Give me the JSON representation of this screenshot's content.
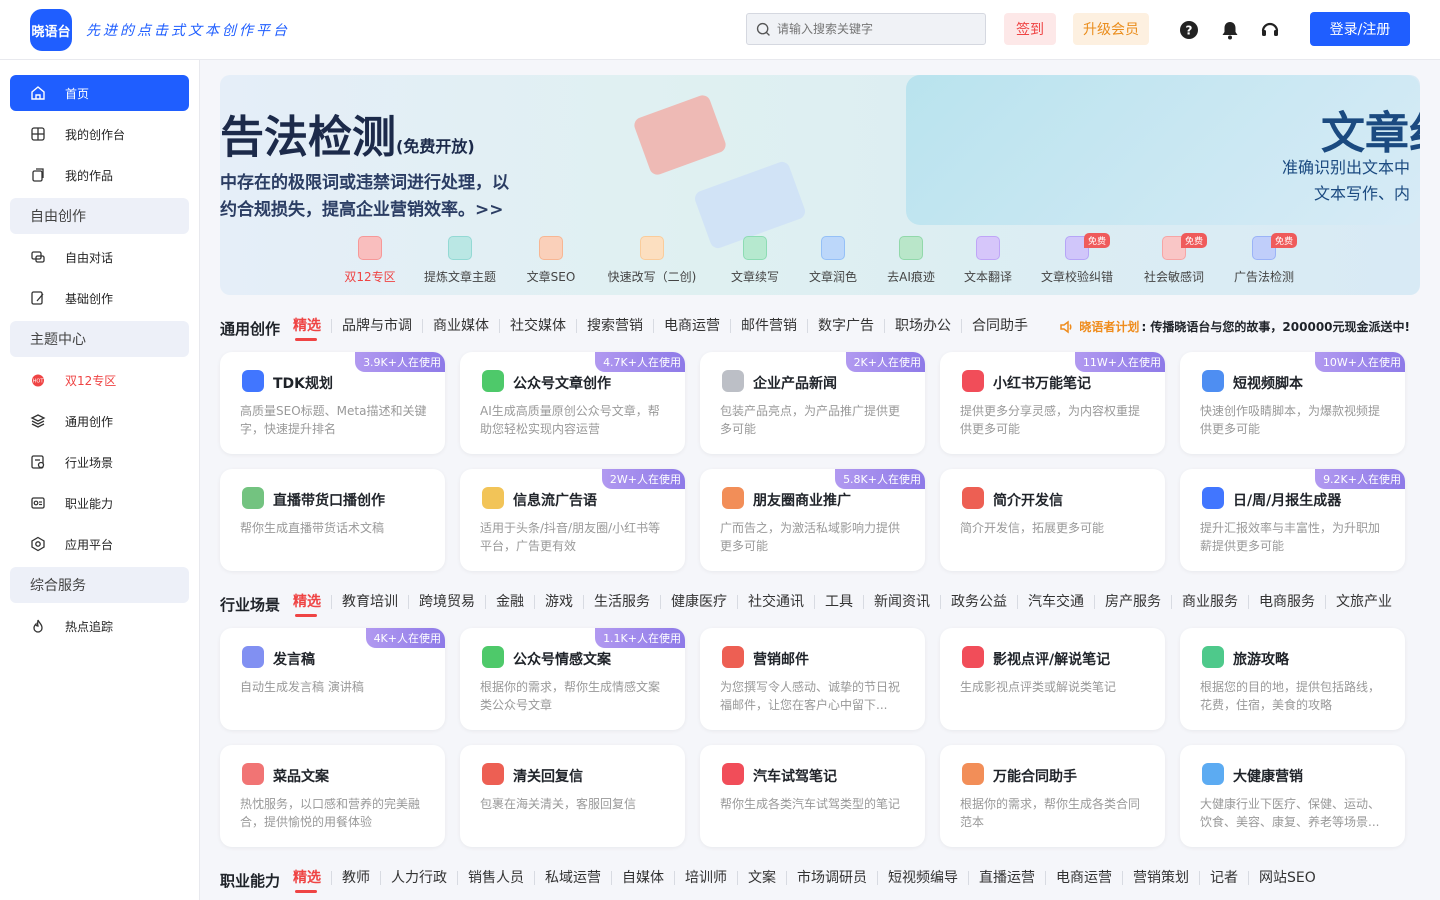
{
  "header": {
    "logo_text": "晓语台",
    "slogan": "先进的点击式文本创作平台",
    "search_placeholder": "请输入搜索关键字",
    "signin_label": "签到",
    "vip_label": "升级会员",
    "login_label": "登录/注册"
  },
  "sidebar": {
    "items": [
      {
        "label": "首页",
        "icon": "home-icon"
      },
      {
        "label": "我的创作台",
        "icon": "workbench-icon"
      },
      {
        "label": "我的作品",
        "icon": "works-icon"
      },
      {
        "label": "自由对话",
        "icon": "chat-icon"
      },
      {
        "label": "基础创作",
        "icon": "edit-icon"
      },
      {
        "label": "双12专区",
        "icon": "hot-icon"
      },
      {
        "label": "通用创作",
        "icon": "layers-icon"
      },
      {
        "label": "行业场景",
        "icon": "scene-icon"
      },
      {
        "label": "职业能力",
        "icon": "profession-icon"
      },
      {
        "label": "应用平台",
        "icon": "platform-icon"
      },
      {
        "label": "热点追踪",
        "icon": "trend-icon"
      }
    ],
    "groups": [
      "自由创作",
      "主题中心",
      "综合服务"
    ]
  },
  "banner": {
    "title": "告法检测",
    "title_suffix": "(免费开放)",
    "desc_line1": "中存在的极限词或违禁词进行处理，以",
    "desc_line2": "约合规损失，提高企业营销效率。>>",
    "b2_title": "文章纠",
    "b2_line1": "准确识别出文本中",
    "b2_line2": "文本写作、内",
    "items": [
      {
        "label": "双12专区",
        "color": "#ef4444",
        "free": ""
      },
      {
        "label": "提炼文章主题",
        "color": "#3bb9b1",
        "free": ""
      },
      {
        "label": "文章SEO",
        "color": "#f07a3a",
        "free": ""
      },
      {
        "label": "快速改写（二创)",
        "color": "#f5a34a",
        "free": ""
      },
      {
        "label": "文章续写",
        "color": "#2fbf77",
        "free": ""
      },
      {
        "label": "文章润色",
        "color": "#3f8cf0",
        "free": ""
      },
      {
        "label": "去AI痕迹",
        "color": "#37b865",
        "free": ""
      },
      {
        "label": "文本翻译",
        "color": "#8a5cf0",
        "free": ""
      },
      {
        "label": "文章校验纠错",
        "color": "#7a5cf0",
        "free": "免费"
      },
      {
        "label": "社会敏感词",
        "color": "#ef5b5b",
        "free": "免费"
      },
      {
        "label": "广告法检测",
        "color": "#4a74f0",
        "free": "免费"
      }
    ]
  },
  "sections": [
    {
      "heading": "通用创作",
      "tabs": [
        "精选",
        "品牌与市调",
        "商业媒体",
        "社交媒体",
        "搜索营销",
        "电商运营",
        "邮件营销",
        "数字广告",
        "职场办公",
        "合同助手"
      ]
    },
    {
      "heading": "行业场景",
      "tabs": [
        "精选",
        "教育培训",
        "跨境贸易",
        "金融",
        "游戏",
        "生活服务",
        "健康医疗",
        "社交通讯",
        "工具",
        "新闻资讯",
        "政务公益",
        "汽车交通",
        "房产服务",
        "商业服务",
        "电商服务",
        "文旅产业"
      ]
    },
    {
      "heading": "职业能力",
      "tabs": [
        "精选",
        "教师",
        "人力行政",
        "销售人员",
        "私域运营",
        "自媒体",
        "培训师",
        "文案",
        "市场调研员",
        "短视频编导",
        "直播运营",
        "电商运营",
        "营销策划",
        "记者",
        "网站SEO"
      ]
    }
  ],
  "notice": {
    "prefix": "晓语者计划",
    "text": ": 传播晓语台与您的故事，200000元现金派送中!"
  },
  "cards": [
    {
      "title": "TDK规划",
      "desc": "高质量SEO标题、Meta描述和关键字，快速提升排名",
      "badge": "3.9K+人在使用",
      "icon": "tdk-icon",
      "color": "#1f5eff"
    },
    {
      "title": "公众号文章创作",
      "desc": "AI生成高质量原创公众号文章，帮助您轻松实现内容运营",
      "badge": "4.7K+人在使用",
      "icon": "wechat-icon",
      "color": "#2fbf50"
    },
    {
      "title": "企业产品新闻",
      "desc": "包装产品亮点，为产品推广提供更多可能",
      "badge": "2K+人在使用",
      "icon": "news-icon",
      "color": "#b0b4bc"
    },
    {
      "title": "小红书万能笔记",
      "desc": "提供更多分享灵感，为内容权重提供更多可能",
      "badge": "11W+人在使用",
      "icon": "xiaohongshu-icon",
      "color": "#ef2d3c"
    },
    {
      "title": "短视频脚本",
      "desc": "快速创作吸睛脚本，为爆款视频提供更多可能",
      "badge": "10W+人在使用",
      "icon": "video-icon",
      "color": "#2f7af0"
    },
    {
      "title": "直播带货口播创作",
      "desc": "帮你生成直播带货话术文稿",
      "badge": "",
      "icon": "live-icon",
      "color": "#5ab86a"
    },
    {
      "title": "信息流广告语",
      "desc": "适用于头条/抖音/朋友圈/小红书等平台，广告更有效",
      "badge": "2W+人在使用",
      "icon": "feed-ad-icon",
      "color": "#f0b93a"
    },
    {
      "title": "朋友圈商业推广",
      "desc": "广而告之，为激活私域影响力提供更多可能",
      "badge": "5.8K+人在使用",
      "icon": "moments-icon",
      "color": "#f07a3a"
    },
    {
      "title": "简介开发信",
      "desc": "简介开发信，拓展更多可能",
      "badge": "",
      "icon": "gmail-icon",
      "color": "#ea4335"
    },
    {
      "title": "日/周/月报生成器",
      "desc": "提升汇报效率与丰富性，为升职加薪提供更多可能",
      "badge": "9.2K+人在使用",
      "icon": "report-icon",
      "color": "#1f5eff"
    },
    {
      "title": "发言稿",
      "desc": "自动生成发言稿 演讲稿",
      "badge": "4K+人在使用",
      "icon": "speech-icon",
      "color": "#6b7cf0"
    },
    {
      "title": "公众号情感文案",
      "desc": "根据你的需求，帮你生成情感文案类公众号文章",
      "badge": "1.1K+人在使用",
      "icon": "wechat-icon",
      "color": "#2fbf50"
    },
    {
      "title": "营销邮件",
      "desc": "为您撰写令人感动、诚挚的节日祝福邮件，让您在客户心中留下...",
      "badge": "",
      "icon": "gmail-icon",
      "color": "#ea4335"
    },
    {
      "title": "影视点评/解说笔记",
      "desc": "生成影视点评类或解说类笔记",
      "badge": "",
      "icon": "xiaohongshu-icon",
      "color": "#ef2d3c"
    },
    {
      "title": "旅游攻略",
      "desc": "根据您的目的地，提供包括路线，花费，住宿，美食的攻略",
      "badge": "",
      "icon": "travel-icon",
      "color": "#2fbf77"
    },
    {
      "title": "菜品文案",
      "desc": "热忱服务，以口感和营养的完美融合，提供愉悦的用餐体验",
      "badge": "",
      "icon": "dish-icon",
      "color": "#ef5b5b"
    },
    {
      "title": "清关回复信",
      "desc": "包裹在海关清关，客服回复信",
      "badge": "",
      "icon": "gmail-icon",
      "color": "#ea4335"
    },
    {
      "title": "汽车试驾笔记",
      "desc": "帮你生成各类汽车试驾类型的笔记",
      "badge": "",
      "icon": "xiaohongshu-icon",
      "color": "#ef2d3c"
    },
    {
      "title": "万能合同助手",
      "desc": "根据你的需求，帮你生成各类合同范本",
      "badge": "",
      "icon": "contract-icon",
      "color": "#f07a3a"
    },
    {
      "title": "大健康营销",
      "desc": "大健康行业下医疗、保健、运动、饮食、美容、康复、养老等场景...",
      "badge": "",
      "icon": "health-icon",
      "color": "#3f9cf0"
    }
  ]
}
